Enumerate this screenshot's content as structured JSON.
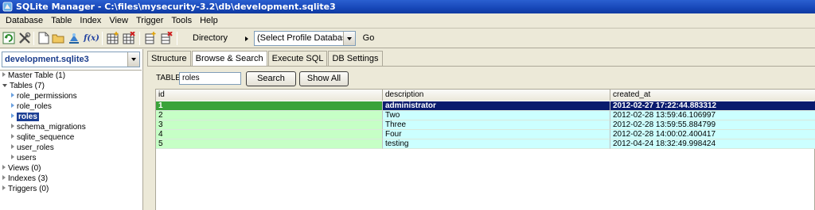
{
  "window": {
    "title": "SQLite Manager - C:\\files\\mysecurity-3.2\\db\\development.sqlite3"
  },
  "menu": [
    "Database",
    "Table",
    "Index",
    "View",
    "Trigger",
    "Tools",
    "Help"
  ],
  "toolbar": {
    "directory_label": "Directory",
    "profile_select": "(Select Profile Database)",
    "go_label": "Go",
    "fx_label": "f(x)"
  },
  "sidebar": {
    "db_select": "development.sqlite3",
    "tree": {
      "master": "Master Table (1)",
      "tables": "Tables (7)",
      "table_items": [
        "role_permissions",
        "role_roles",
        "roles",
        "schema_migrations",
        "sqlite_sequence",
        "user_roles",
        "users"
      ],
      "views": "Views (0)",
      "indexes": "Indexes (3)",
      "triggers": "Triggers (0)"
    }
  },
  "tabs": [
    "Structure",
    "Browse & Search",
    "Execute SQL",
    "DB Settings"
  ],
  "browse": {
    "table_label": "TABLE",
    "table_value": "roles",
    "search_label": "Search",
    "show_all_label": "Show All",
    "columns": [
      "id",
      "description",
      "created_at"
    ],
    "rows": [
      {
        "id": "1",
        "description": "administrator",
        "created_at": "2012-02-27 17:22:44.883312"
      },
      {
        "id": "2",
        "description": "Two",
        "created_at": "2012-02-28 13:59:46.106997"
      },
      {
        "id": "3",
        "description": "Three",
        "created_at": "2012-02-28 13:59:55.884799"
      },
      {
        "id": "4",
        "description": "Four",
        "created_at": "2012-02-28 14:00:02.400417"
      },
      {
        "id": "5",
        "description": "testing",
        "created_at": "2012-04-24 18:32:49.998424"
      }
    ]
  },
  "colors": {
    "selected_id": "#3aa33a",
    "selected_row": "#0a1b6e",
    "id_cell": "#c6ffc6",
    "data_cell": "#ccffff",
    "titlebar": "#1747b8"
  }
}
